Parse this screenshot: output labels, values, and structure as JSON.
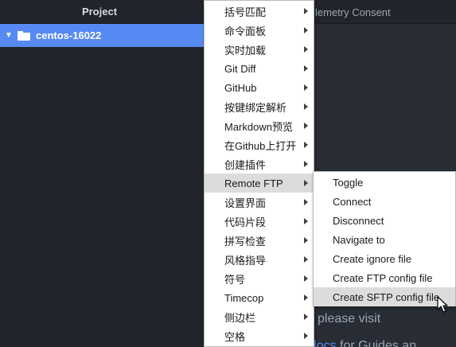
{
  "project_panel": {
    "header_title": "Project",
    "root_folder": "centos-16022"
  },
  "editor": {
    "tab_title": "lemetry Consent",
    "welcome_text": "please visit",
    "docs_prefix": "",
    "docs_link": "Atom docs",
    "docs_suffix": " for Guides an"
  },
  "context_menu": {
    "items": [
      {
        "label": "括号匹配"
      },
      {
        "label": "命令面板"
      },
      {
        "label": "实时加载"
      },
      {
        "label": "Git Diff"
      },
      {
        "label": "GitHub"
      },
      {
        "label": "按键绑定解析"
      },
      {
        "label": "Markdown预览"
      },
      {
        "label": "在Github上打开"
      },
      {
        "label": "创建插件"
      },
      {
        "label": "Remote FTP"
      },
      {
        "label": "设置界面"
      },
      {
        "label": "代码片段"
      },
      {
        "label": "拼写检查"
      },
      {
        "label": "风格指导"
      },
      {
        "label": "符号"
      },
      {
        "label": "Timecop"
      },
      {
        "label": "侧边栏"
      },
      {
        "label": "空格"
      }
    ]
  },
  "submenu": {
    "items": [
      {
        "label": "Toggle"
      },
      {
        "label": "Connect"
      },
      {
        "label": "Disconnect"
      },
      {
        "label": "Navigate to"
      },
      {
        "label": "Create ignore file"
      },
      {
        "label": "Create FTP config file"
      },
      {
        "label": "Create SFTP config file"
      }
    ]
  },
  "colors": {
    "panel_bg": "#21252b",
    "editor_bg": "#282c34",
    "selection": "#568af2",
    "menu_bg": "#ffffff",
    "menu_highlight": "#dcdcdc"
  }
}
